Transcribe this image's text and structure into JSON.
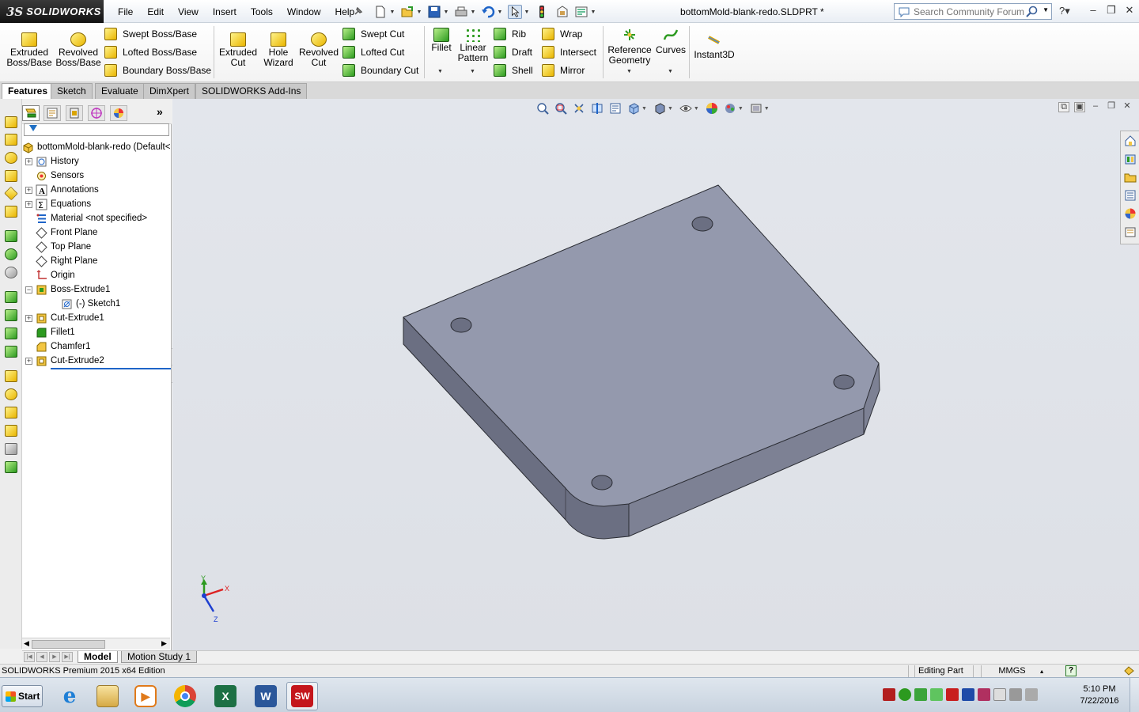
{
  "app": {
    "brand": "SOLIDWORKS",
    "document_title": "bottomMold-blank-redo.SLDPRT *"
  },
  "menu": [
    "File",
    "Edit",
    "View",
    "Insert",
    "Tools",
    "Window",
    "Help"
  ],
  "search": {
    "placeholder": "Search Community Forum"
  },
  "commands": {
    "extruded_boss": [
      "Extruded",
      "Boss/Base"
    ],
    "revolved_boss": [
      "Revolved",
      "Boss/Base"
    ],
    "swept_boss": "Swept Boss/Base",
    "lofted_boss": "Lofted Boss/Base",
    "boundary_boss": "Boundary Boss/Base",
    "extruded_cut": [
      "Extruded",
      "Cut"
    ],
    "hole_wizard": [
      "Hole",
      "Wizard"
    ],
    "revolved_cut": [
      "Revolved",
      "Cut"
    ],
    "swept_cut": "Swept Cut",
    "lofted_cut": "Lofted Cut",
    "boundary_cut": "Boundary Cut",
    "fillet": "Fillet",
    "linear_pattern": [
      "Linear",
      "Pattern"
    ],
    "rib": "Rib",
    "draft": "Draft",
    "shell": "Shell",
    "wrap": "Wrap",
    "intersect": "Intersect",
    "mirror": "Mirror",
    "reference_geometry": [
      "Reference",
      "Geometry"
    ],
    "curves": "Curves",
    "instant3d": "Instant3D"
  },
  "tabs": [
    "Features",
    "Sketch",
    "Evaluate",
    "DimXpert",
    "SOLIDWORKS Add-Ins"
  ],
  "tree": {
    "root": "bottomMold-blank-redo  (Default<",
    "items": [
      {
        "label": "History",
        "expandable": true,
        "indent": 0,
        "icon": "history-icon"
      },
      {
        "label": "Sensors",
        "expandable": false,
        "indent": 0,
        "icon": "sensor-icon"
      },
      {
        "label": "Annotations",
        "expandable": true,
        "indent": 0,
        "icon": "annotations-icon"
      },
      {
        "label": "Equations",
        "expandable": true,
        "indent": 0,
        "icon": "equations-icon"
      },
      {
        "label": "Material <not specified>",
        "expandable": false,
        "indent": 0,
        "icon": "material-icon"
      },
      {
        "label": "Front Plane",
        "expandable": false,
        "indent": 0,
        "icon": "plane-icon"
      },
      {
        "label": "Top Plane",
        "expandable": false,
        "indent": 0,
        "icon": "plane-icon"
      },
      {
        "label": "Right Plane",
        "expandable": false,
        "indent": 0,
        "icon": "plane-icon"
      },
      {
        "label": "Origin",
        "expandable": false,
        "indent": 0,
        "icon": "origin-icon"
      },
      {
        "label": "Boss-Extrude1",
        "expandable": true,
        "expanded": true,
        "indent": 0,
        "icon": "boss-extrude-icon"
      },
      {
        "label": "(-) Sketch1",
        "expandable": false,
        "indent": 1,
        "icon": "sketch-icon"
      },
      {
        "label": "Cut-Extrude1",
        "expandable": true,
        "indent": 0,
        "icon": "cut-extrude-icon"
      },
      {
        "label": "Fillet1",
        "expandable": false,
        "indent": 0,
        "icon": "fillet-icon"
      },
      {
        "label": "Chamfer1",
        "expandable": false,
        "indent": 0,
        "icon": "chamfer-icon"
      },
      {
        "label": "Cut-Extrude2",
        "expandable": true,
        "indent": 0,
        "icon": "cut-extrude-icon"
      }
    ]
  },
  "triad": {
    "x": "X",
    "y": "Y",
    "z": "Z"
  },
  "bottom_tabs": [
    "Model",
    "Motion Study 1"
  ],
  "status": {
    "edition": "SOLIDWORKS Premium 2015 x64 Edition",
    "mode": "Editing Part",
    "units": "MMGS"
  },
  "taskbar": {
    "start": "Start",
    "time": "5:10 PM",
    "date": "7/22/2016"
  },
  "colors": {
    "part_top": "#9499ad",
    "part_side_front": "#6b6f82",
    "part_side_right": "#7d8194",
    "viewport_bg": "#e1e4ea"
  }
}
